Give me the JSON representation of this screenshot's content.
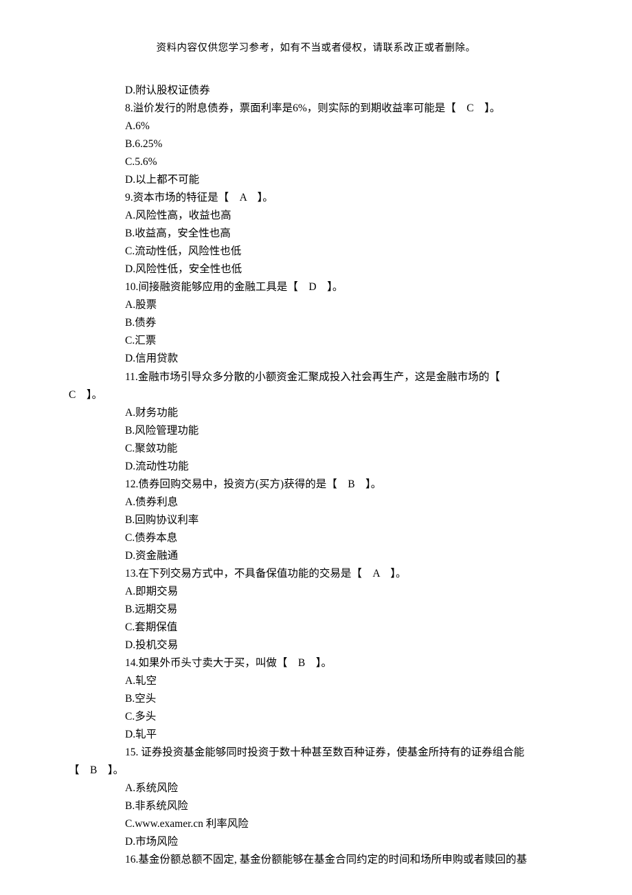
{
  "header": "资料内容仅供您学习参考，如有不当或者侵权，请联系改正或者删除。",
  "lines": [
    {
      "cls": "option",
      "t": "D.附认股权证债券"
    },
    {
      "cls": "question",
      "t": "8.溢价发行的附息债券，票面利率是6%，则实际的到期收益率可能是【　C　】。"
    },
    {
      "cls": "option",
      "t": "A.6%"
    },
    {
      "cls": "option",
      "t": "B.6.25%"
    },
    {
      "cls": "option",
      "t": "C.5.6%"
    },
    {
      "cls": "option",
      "t": "D.以上都不可能"
    },
    {
      "cls": "question",
      "t": "9.资本市场的特征是【　A　】。"
    },
    {
      "cls": "option",
      "t": "A.风险性高，收益也高"
    },
    {
      "cls": "option",
      "t": "B.收益高，安全性也高"
    },
    {
      "cls": "option",
      "t": "C.流动性低，风险性也低"
    },
    {
      "cls": "option",
      "t": "D.风险性低，安全性也低"
    },
    {
      "cls": "question",
      "t": "10.间接融资能够应用的金融工具是【　D　】。"
    },
    {
      "cls": "option",
      "t": "A.股票"
    },
    {
      "cls": "option",
      "t": "B.债券"
    },
    {
      "cls": "option",
      "t": "C.汇票"
    },
    {
      "cls": "option",
      "t": "D.信用贷款"
    },
    {
      "cls": "question",
      "t": "11.金融市场引导众多分散的小额资金汇聚成投入社会再生产，这是金融市场的【"
    },
    {
      "cls": "wrap-cont",
      "t": "C　】。"
    },
    {
      "cls": "option",
      "t": "A.财务功能"
    },
    {
      "cls": "option",
      "t": "B.风险管理功能"
    },
    {
      "cls": "option",
      "t": "C.聚敛功能"
    },
    {
      "cls": "option",
      "t": "D.流动性功能"
    },
    {
      "cls": "question",
      "t": "12.债券回购交易中，投资方(买方)获得的是【　B　】。"
    },
    {
      "cls": "option",
      "t": "A.债券利息"
    },
    {
      "cls": "option",
      "t": "B.回购协议利率"
    },
    {
      "cls": "option",
      "t": "C.债券本息"
    },
    {
      "cls": "option",
      "t": "D.资金融通"
    },
    {
      "cls": "question",
      "t": "13.在下列交易方式中，不具备保值功能的交易是【　A　】。"
    },
    {
      "cls": "option",
      "t": "A.即期交易"
    },
    {
      "cls": "option",
      "t": "B.远期交易"
    },
    {
      "cls": "option",
      "t": "C.套期保值"
    },
    {
      "cls": "option",
      "t": "D.投机交易"
    },
    {
      "cls": "question",
      "t": "14.如果外币头寸卖大于买，叫做【　B　】。"
    },
    {
      "cls": "option",
      "t": "A.轧空"
    },
    {
      "cls": "option",
      "t": "B.空头"
    },
    {
      "cls": "option",
      "t": "C.多头"
    },
    {
      "cls": "option",
      "t": "D.轧平"
    },
    {
      "cls": "question",
      "t": "15. 证券投资基金能够同时投资于数十种甚至数百种证券，使基金所持有的证券组合能"
    },
    {
      "cls": "wrap-cont",
      "t": "【　B　】。"
    },
    {
      "cls": "option",
      "t": "A.系统风险"
    },
    {
      "cls": "option",
      "t": "B.非系统风险"
    },
    {
      "cls": "option",
      "t": "C.www.examer.cn 利率风险"
    },
    {
      "cls": "option",
      "t": "D.市场风险"
    },
    {
      "cls": "question",
      "t": "16.基金份额总额不固定, 基金份额能够在基金合同约定的时间和场所申购或者赎回的基"
    }
  ]
}
